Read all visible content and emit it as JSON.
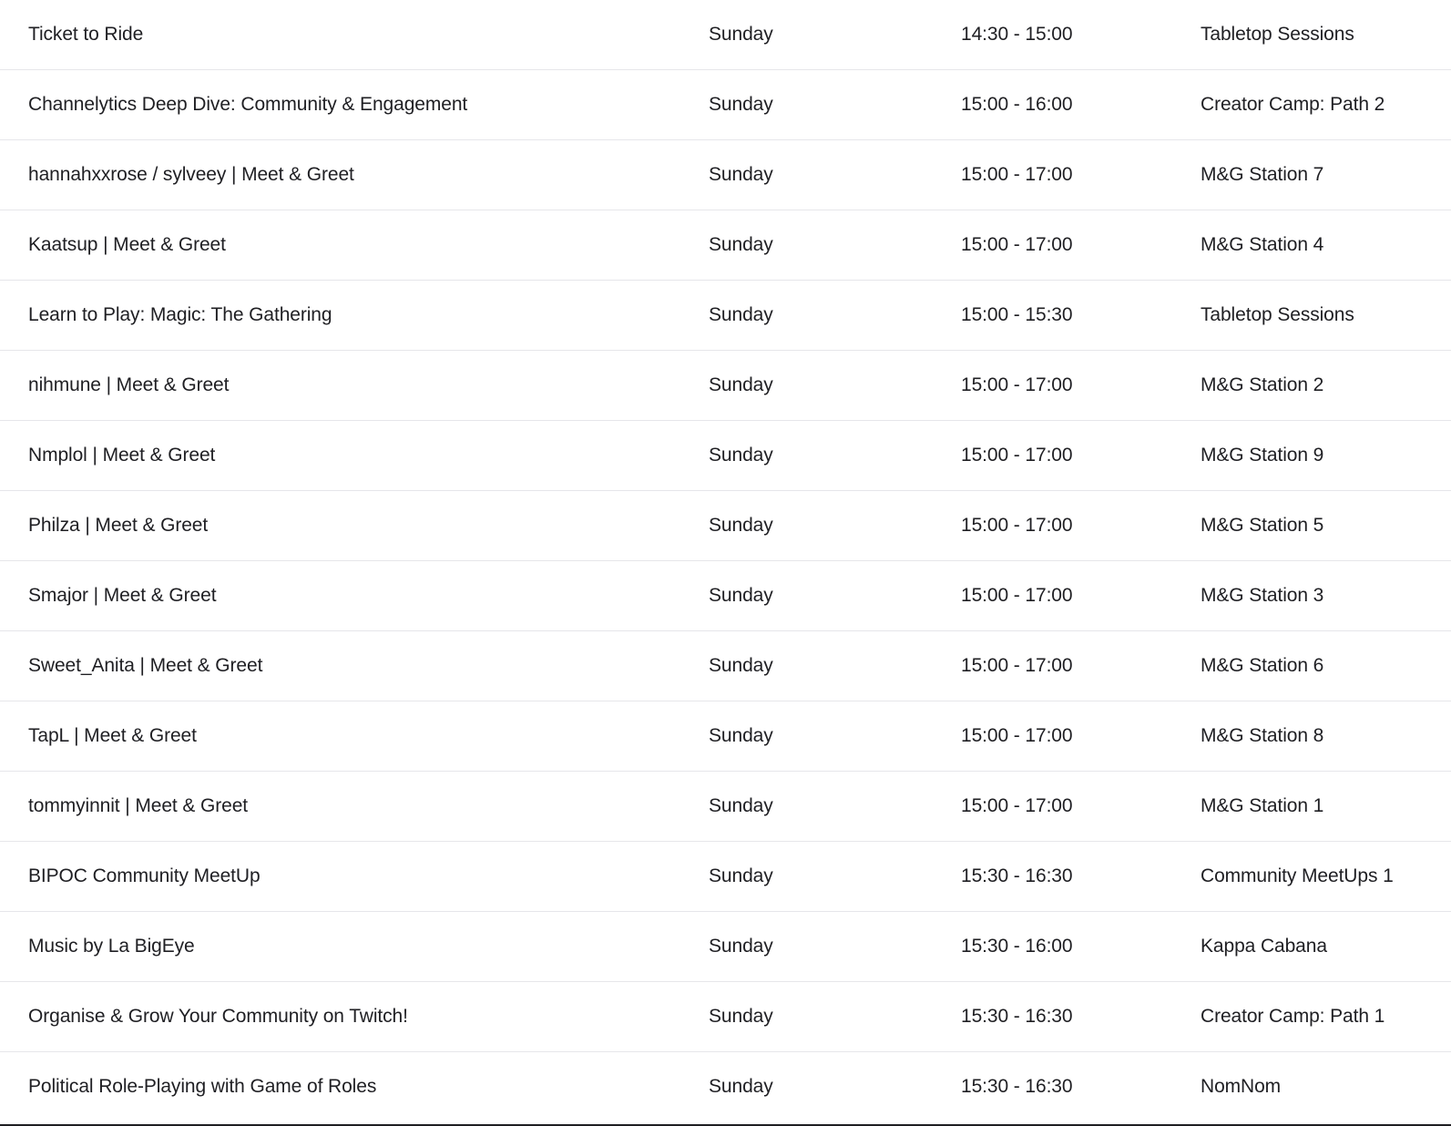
{
  "schedule": {
    "rows": [
      {
        "title": "Ticket to Ride",
        "day": "Sunday",
        "time": "14:30 - 15:00",
        "location": "Tabletop Sessions"
      },
      {
        "title": "Channelytics Deep Dive: Community & Engagement",
        "day": "Sunday",
        "time": "15:00 - 16:00",
        "location": "Creator Camp: Path 2"
      },
      {
        "title": "hannahxxrose / sylveey | Meet & Greet",
        "day": "Sunday",
        "time": "15:00 - 17:00",
        "location": "M&G Station 7"
      },
      {
        "title": "Kaatsup | Meet & Greet",
        "day": "Sunday",
        "time": "15:00 - 17:00",
        "location": "M&G Station 4"
      },
      {
        "title": "Learn to Play: Magic: The Gathering",
        "day": "Sunday",
        "time": "15:00 - 15:30",
        "location": "Tabletop Sessions"
      },
      {
        "title": "nihmune | Meet & Greet",
        "day": "Sunday",
        "time": "15:00 - 17:00",
        "location": "M&G Station 2"
      },
      {
        "title": "Nmplol | Meet & Greet",
        "day": "Sunday",
        "time": "15:00 - 17:00",
        "location": "M&G Station 9"
      },
      {
        "title": "Philza | Meet & Greet",
        "day": "Sunday",
        "time": "15:00 - 17:00",
        "location": "M&G Station 5"
      },
      {
        "title": "Smajor | Meet & Greet",
        "day": "Sunday",
        "time": "15:00 - 17:00",
        "location": "M&G Station 3"
      },
      {
        "title": "Sweet_Anita | Meet & Greet",
        "day": "Sunday",
        "time": "15:00 - 17:00",
        "location": "M&G Station 6"
      },
      {
        "title": "TapL | Meet & Greet",
        "day": "Sunday",
        "time": "15:00 - 17:00",
        "location": "M&G Station 8"
      },
      {
        "title": "tommyinnit | Meet & Greet",
        "day": "Sunday",
        "time": "15:00 - 17:00",
        "location": "M&G Station 1"
      },
      {
        "title": "BIPOC Community MeetUp",
        "day": "Sunday",
        "time": "15:30 - 16:30",
        "location": "Community MeetUps 1"
      },
      {
        "title": "Music by La BigEye",
        "day": "Sunday",
        "time": "15:30 - 16:00",
        "location": "Kappa Cabana"
      },
      {
        "title": "Organise & Grow Your Community on Twitch!",
        "day": "Sunday",
        "time": "15:30 - 16:30",
        "location": "Creator Camp: Path 1"
      },
      {
        "title": "Political Role-Playing with Game of Roles",
        "day": "Sunday",
        "time": "15:30 - 16:30",
        "location": "NomNom"
      }
    ]
  }
}
